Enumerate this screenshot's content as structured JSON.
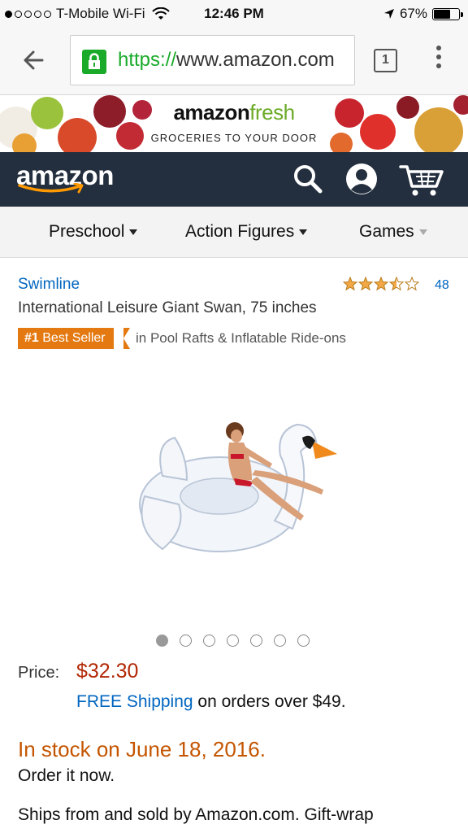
{
  "status_bar": {
    "carrier": "T-Mobile Wi-Fi",
    "time": "12:46 PM",
    "battery": "67%",
    "battery_level": 0.67,
    "signal_bars_filled": 1,
    "signal_bars_total": 5
  },
  "browser": {
    "url_scheme": "https://",
    "url_host": "www.amazon.com",
    "tab_count": "1"
  },
  "banner": {
    "logo_amazon": "amazon",
    "logo_fresh": "fresh",
    "tagline": "GROCERIES TO YOUR DOOR"
  },
  "header": {
    "logo": "amazon",
    "icons": [
      "search-icon",
      "account-icon",
      "cart-icon"
    ]
  },
  "categories": [
    {
      "label": "Preschool"
    },
    {
      "label": "Action Figures"
    },
    {
      "label": "Games"
    }
  ],
  "product": {
    "brand": "Swimline",
    "title": "International Leisure Giant Swan, 75 inches",
    "rating": 3.5,
    "rating_count": "48",
    "best_seller_rank": "#1",
    "best_seller_label": "Best Seller",
    "best_seller_category": "in Pool Rafts & Inflatable Ride-ons",
    "image_count": 7,
    "active_image": 1,
    "price_label": "Price:",
    "price": "$32.30",
    "shipping_link": "FREE Shipping",
    "shipping_text": "on orders over $49.",
    "stock": "In stock on June 18, 2016.",
    "order_now": "Order it now.",
    "ships_from": "Ships from and sold by Amazon.com. Gift-wrap available."
  },
  "colors": {
    "header_bg": "#232f3e",
    "link": "#0066c0",
    "price": "#b12704",
    "stock": "#c45500",
    "badge": "#e47911",
    "fresh_green": "#6bab28"
  }
}
